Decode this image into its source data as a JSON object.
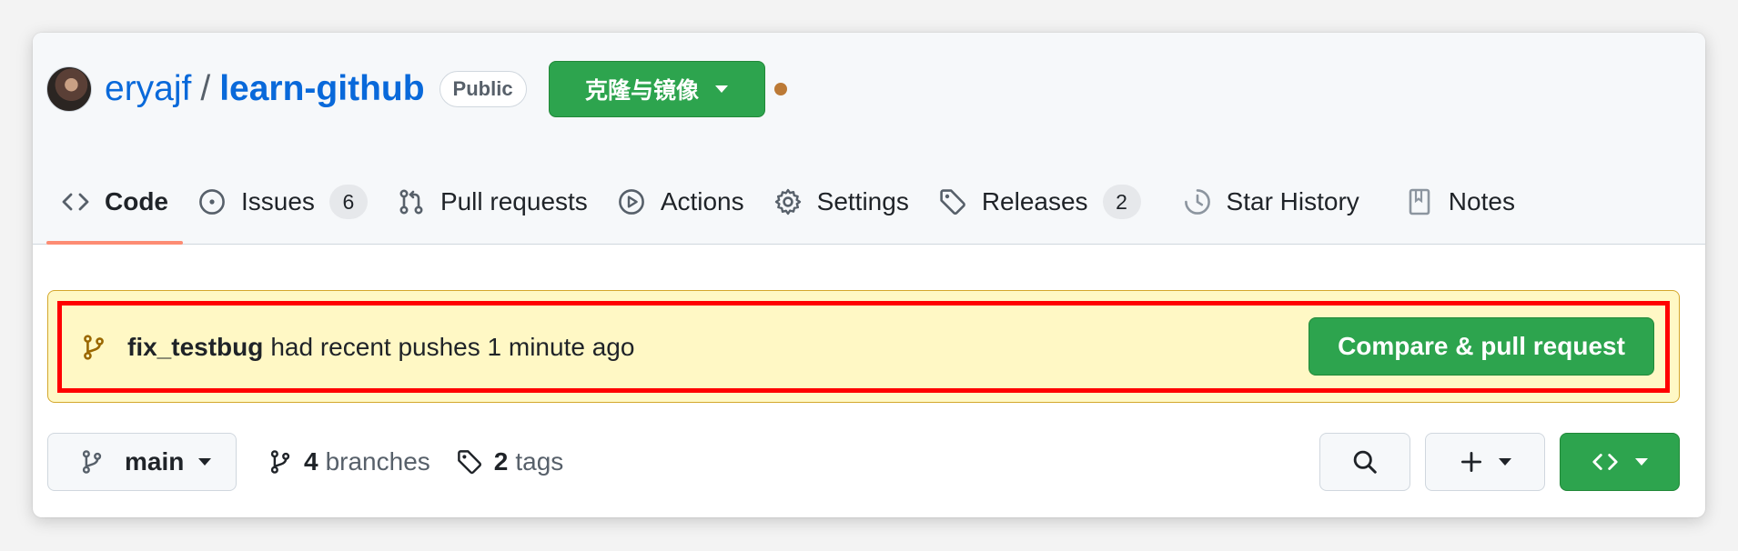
{
  "repo": {
    "owner": "eryajf",
    "separator": "/",
    "name": "learn-github",
    "visibility": "Public",
    "mirror_button_label": "克隆与镜像"
  },
  "tabs": [
    {
      "label": "Code",
      "icon": "code-icon",
      "active": true
    },
    {
      "label": "Issues",
      "icon": "issue-icon",
      "count": "6"
    },
    {
      "label": "Pull requests",
      "icon": "pull-request-icon"
    },
    {
      "label": "Actions",
      "icon": "play-icon"
    },
    {
      "label": "Settings",
      "icon": "gear-icon"
    },
    {
      "label": "Releases",
      "icon": "tag-icon",
      "count": "2"
    },
    {
      "label": "Star History",
      "icon": "history-icon"
    },
    {
      "label": "Notes",
      "icon": "notebook-icon"
    }
  ],
  "banner": {
    "branch": "fix_testbug",
    "message": "had recent pushes 1 minute ago",
    "button_label": "Compare & pull request",
    "highlight_color": "#ff0000",
    "background_color": "#fff8c5"
  },
  "bottom": {
    "branch_label": "main",
    "branches_count": "4",
    "branches_label": "branches",
    "tags_count": "2",
    "tags_label": "tags"
  },
  "colors": {
    "accent_green": "#2da44e",
    "link_blue": "#0969da",
    "active_tab_underline": "#fd8c73"
  }
}
